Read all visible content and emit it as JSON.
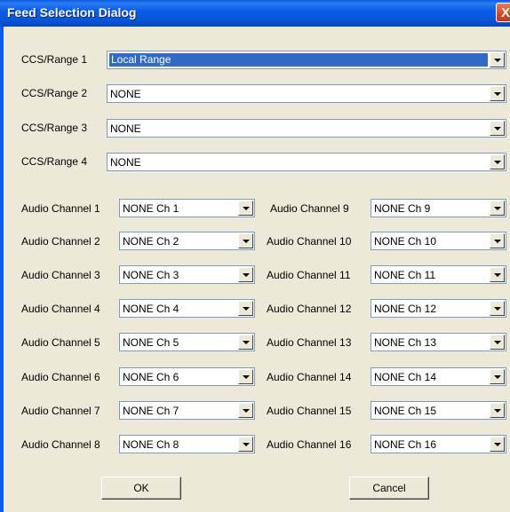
{
  "window": {
    "title": "Feed Selection Dialog",
    "close_glyph": "X"
  },
  "ranges": [
    {
      "label": "CCS/Range 1",
      "value": "Local Range"
    },
    {
      "label": "CCS/Range 2",
      "value": "NONE"
    },
    {
      "label": "CCS/Range 3",
      "value": "NONE"
    },
    {
      "label": "CCS/Range 4",
      "value": "NONE"
    }
  ],
  "audio_left": [
    {
      "label": "Audio Channel 1",
      "value": "NONE Ch 1"
    },
    {
      "label": "Audio Channel 2",
      "value": "NONE Ch 2"
    },
    {
      "label": "Audio Channel 3",
      "value": "NONE Ch 3"
    },
    {
      "label": "Audio Channel 4",
      "value": "NONE Ch 4"
    },
    {
      "label": "Audio Channel 5",
      "value": "NONE Ch 5"
    },
    {
      "label": "Audio Channel 6",
      "value": "NONE Ch 6"
    },
    {
      "label": "Audio Channel 7",
      "value": "NONE Ch 7"
    },
    {
      "label": "Audio Channel 8",
      "value": "NONE Ch 8"
    }
  ],
  "audio_right": [
    {
      "label": "Audio Channel 9",
      "value": "NONE Ch 9"
    },
    {
      "label": "Audio Channel 10",
      "value": "NONE Ch 10"
    },
    {
      "label": "Audio Channel 11",
      "value": "NONE Ch 11"
    },
    {
      "label": "Audio Channel 12",
      "value": "NONE Ch 12"
    },
    {
      "label": "Audio Channel 13",
      "value": "NONE Ch 13"
    },
    {
      "label": "Audio Channel 14",
      "value": "NONE Ch 14"
    },
    {
      "label": "Audio Channel 15",
      "value": "NONE Ch 15"
    },
    {
      "label": "Audio Channel 16",
      "value": "NONE Ch 16"
    }
  ],
  "buttons": {
    "ok": "OK",
    "cancel": "Cancel"
  },
  "colors": {
    "titlebar": "#0a55d8",
    "dialog_bg": "#ece9d8",
    "selection": "#316ac5"
  }
}
